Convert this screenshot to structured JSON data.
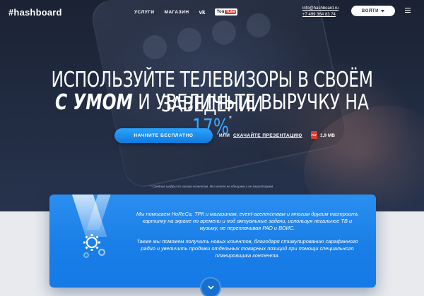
{
  "header": {
    "logo": "#hashboard",
    "nav": [
      {
        "label": "УСЛУГИ"
      },
      {
        "label": "МАГАЗИН"
      }
    ],
    "social": {
      "vk": "vk",
      "youtube_you": "You",
      "youtube_tube": "Tube"
    },
    "contacts": {
      "email": "info@hashboard.ru",
      "phone": "+7 499 364 83 74"
    },
    "login_label": "ВОЙТИ"
  },
  "hero": {
    "line1": "ИСПОЛЬЗУЙТЕ ТЕЛЕВИЗОРЫ В СВОЁМ ЗАВЕДЕНИИ",
    "line2_bold": "С УМОМ",
    "line2_rest": " И УВЕЛИЧЬТЕ ВЫРУЧКУ НА ",
    "line2_pct": "17%",
    "line2_mark": "*",
    "cta_label": "НАЧНИТЕ БЕСПЛАТНО",
    "or_label": "ИЛИ",
    "presentation_label": "СКАЧАЙТЕ ПРЕЗЕНТАЦИЮ",
    "pdf_badge": "PDF",
    "file_size": "1,9 MB",
    "footnote": "* Средние цифры по нашим клиентам. Мы ничего не обещаем и не гарантируем."
  },
  "card": {
    "p1": "Мы помогаем HoReCa, ТРК и магазинам, event-агентствам и многим другим настроить картинку на экране по времени и под актуальные задачи, используя легальное ТВ и музыку, не переплачивая РАО и ВОИС.",
    "p2": "Также мы поможем получить новых клиентов, благодаря стимулированию сарафанного радио и увеличить продажи отдельных товарных позиций при помощи специального планировщика контента."
  },
  "colors": {
    "accent": "#2a9bff",
    "card": "#1e84ec",
    "dark_bg": "#1e273b"
  },
  "icons": [
    "vk-icon",
    "youtube-icon",
    "chevron-down-icon",
    "menu-icon",
    "pdf-icon",
    "gears-icon",
    "scroll-down-icon"
  ]
}
